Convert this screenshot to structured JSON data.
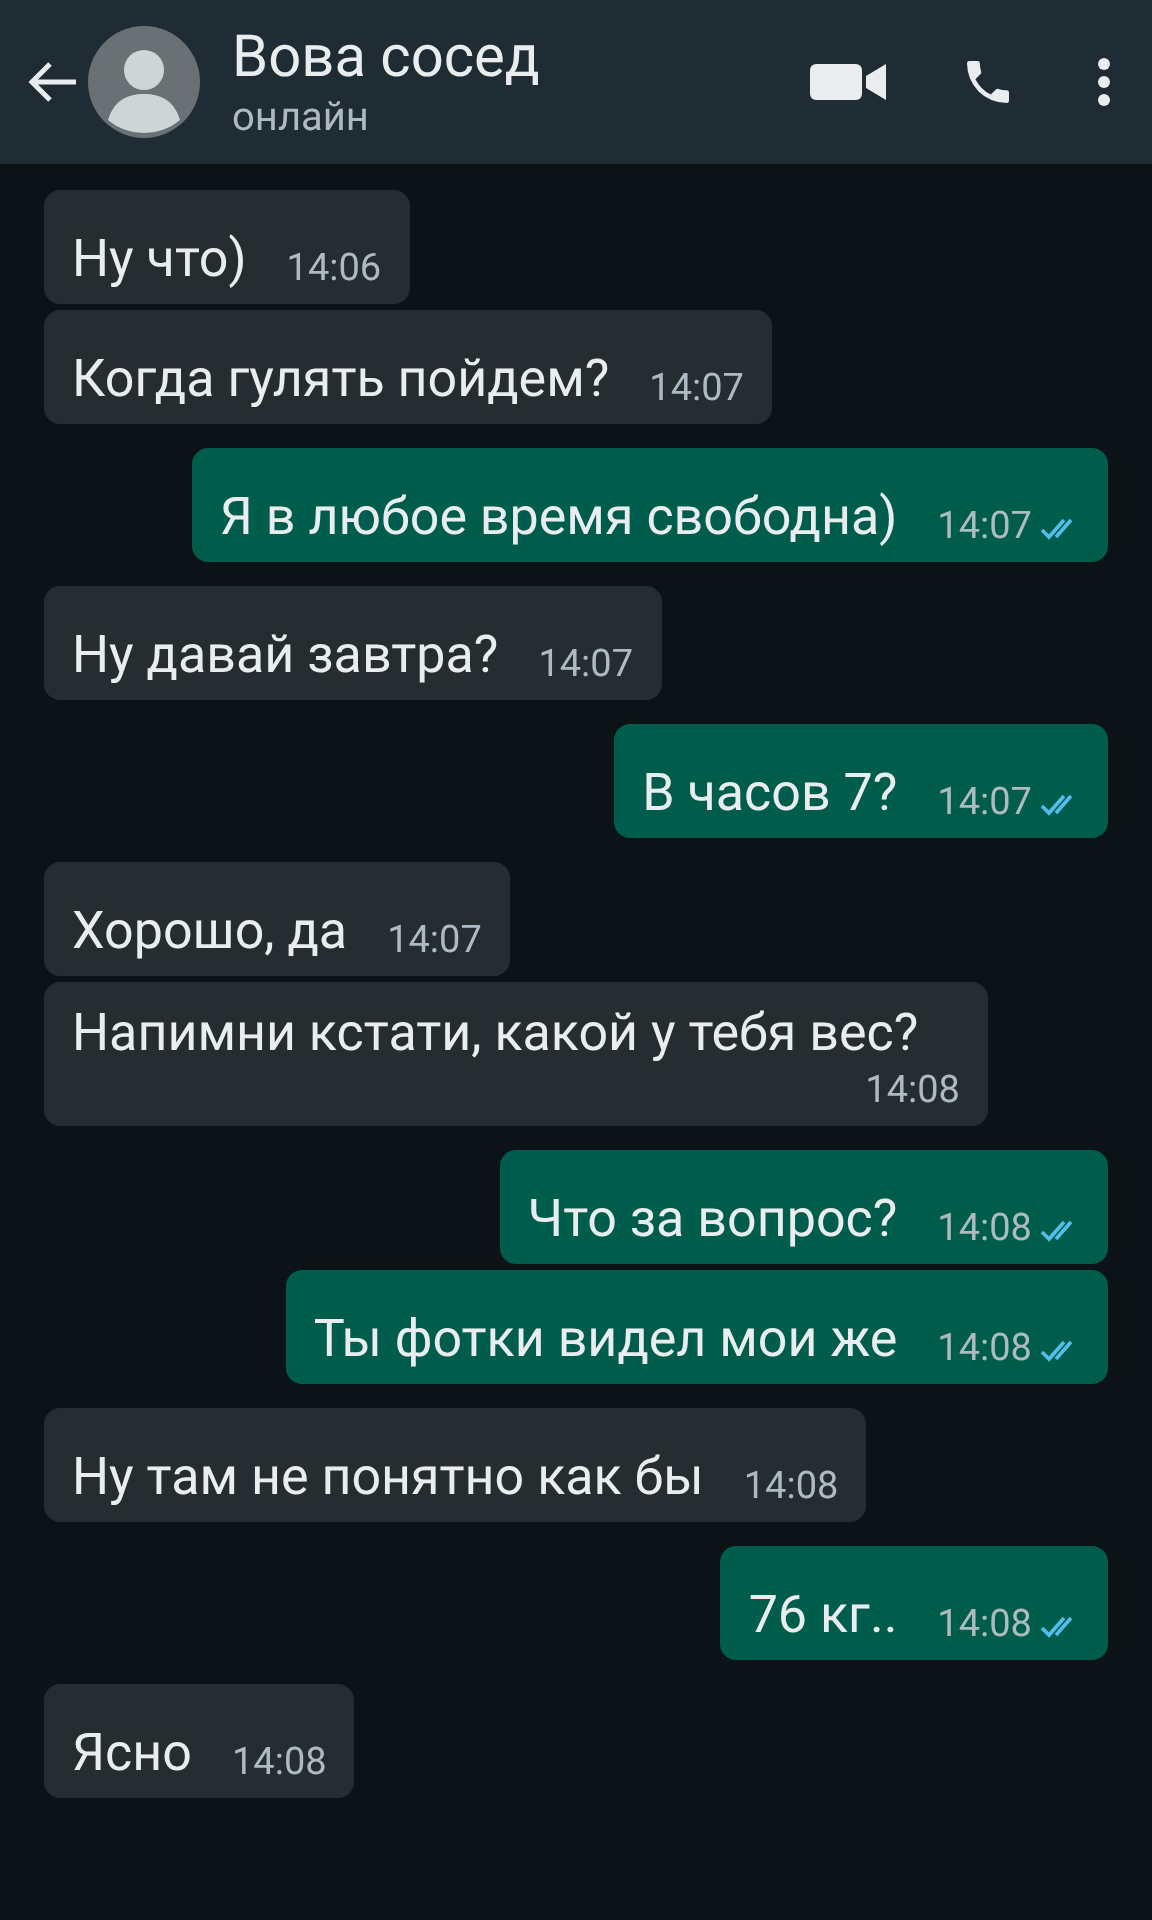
{
  "header": {
    "name": "Вова сосед",
    "status": "онлайн"
  },
  "messages": [
    {
      "kind": "incoming",
      "text": "Ну что)",
      "time": "14:06"
    },
    {
      "kind": "incoming",
      "text": "Когда гулять пойдем?",
      "time": "14:07"
    },
    {
      "kind": "outgoing",
      "text": "Я в любое время свободна)",
      "time": "14:07",
      "read": true
    },
    {
      "kind": "incoming",
      "text": "Ну давай завтра?",
      "time": "14:07"
    },
    {
      "kind": "outgoing",
      "text": "В часов 7?",
      "time": "14:07",
      "read": true
    },
    {
      "kind": "incoming",
      "text": "Хорошо, да",
      "time": "14:07"
    },
    {
      "kind": "incoming",
      "text": "Напимни кстати, какой у тебя вес?",
      "time": "14:08"
    },
    {
      "kind": "outgoing",
      "text": "Что за вопрос?",
      "time": "14:08",
      "read": true
    },
    {
      "kind": "outgoing",
      "text": "Ты фотки видел мои же",
      "time": "14:08",
      "read": true
    },
    {
      "kind": "incoming",
      "text": "Ну там не понятно как бы",
      "time": "14:08"
    },
    {
      "kind": "outgoing",
      "text": "76 кг..",
      "time": "14:08",
      "read": true
    },
    {
      "kind": "incoming",
      "text": "Ясно",
      "time": "14:08"
    }
  ]
}
